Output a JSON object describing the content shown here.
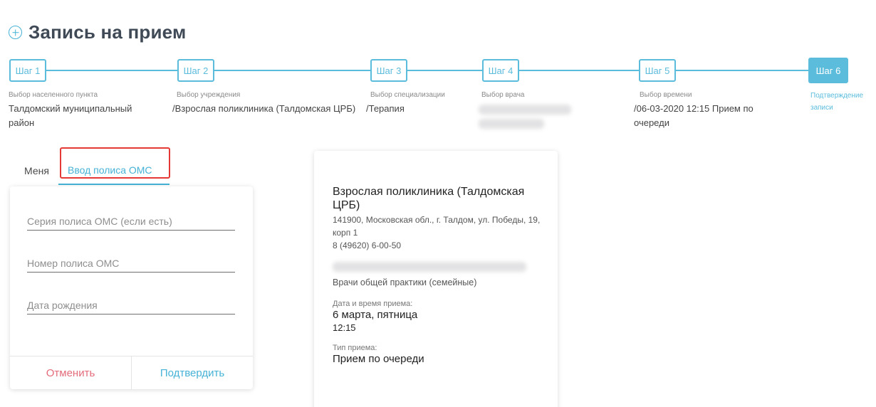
{
  "page": {
    "title": "Запись на прием"
  },
  "steps": [
    {
      "label": "Шаг 1",
      "caption": "Выбор населенного пункта",
      "value": "Талдомский муниципальный район"
    },
    {
      "label": "Шаг 2",
      "caption": "Выбор учреждения",
      "value": "/Взрослая поликлиника (Талдомская ЦРБ)"
    },
    {
      "label": "Шаг 3",
      "caption": "Выбор специализации",
      "value": "/Терапия"
    },
    {
      "label": "Шаг 4",
      "caption": "Выбор врача",
      "value": ""
    },
    {
      "label": "Шаг 5",
      "caption": "Выбор времени",
      "value": "/06-03-2020 12:15 Прием по очереди"
    },
    {
      "label": "Шаг 6",
      "caption": "Подтверждение записи",
      "value": ""
    }
  ],
  "tabs": {
    "me": "Меня",
    "oms": "Ввод полиса ОМС"
  },
  "form": {
    "series_placeholder": "Серия полиса ОМС (если есть)",
    "number_placeholder": "Номер полиса ОМС",
    "birth_placeholder": "Дата рождения",
    "cancel": "Отменить",
    "confirm": "Подтвердить"
  },
  "summary": {
    "org_name": "Взрослая поликлиника (Талдомская ЦРБ)",
    "address": "141900, Московская обл., г. Талдом, ул. Победы, 19, корп 1",
    "phone": "8 (49620) 6-00-50",
    "specialty": "Врачи общей практики (семейные)",
    "datetime_label": "Дата и время приема:",
    "date": "6 марта, пятница",
    "time": "12:15",
    "type_label": "Тип приема:",
    "type_value": "Прием по очереди"
  },
  "colors": {
    "accent": "#5bbcdc",
    "highlight": "#e53935",
    "cancel": "#e36b7a"
  }
}
